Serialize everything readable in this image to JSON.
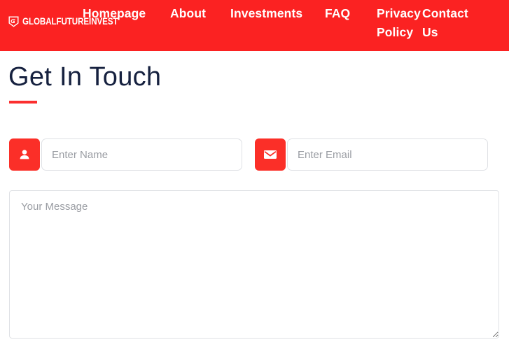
{
  "header": {
    "background_color": "#fb2222",
    "brand": {
      "icon": "shield-g-logo-icon",
      "name": "GLOBALFUTUREINVEST"
    },
    "nav_items": [
      {
        "label": "Homepage"
      },
      {
        "label": "About"
      },
      {
        "label": "Investments"
      },
      {
        "label": "FAQ"
      },
      {
        "label": "Privacy Policy"
      },
      {
        "label": "Contact Us"
      }
    ]
  },
  "main": {
    "title": "Get In Touch",
    "accent_color": "#fb2f2f",
    "title_color": "#16213f",
    "form": {
      "name_field": {
        "icon": "person-icon",
        "value": "",
        "placeholder": "Enter Name"
      },
      "email_field": {
        "icon": "envelope-icon",
        "value": "",
        "placeholder": "Enter Email"
      },
      "message_field": {
        "value": "",
        "placeholder": "Your Message"
      }
    }
  }
}
